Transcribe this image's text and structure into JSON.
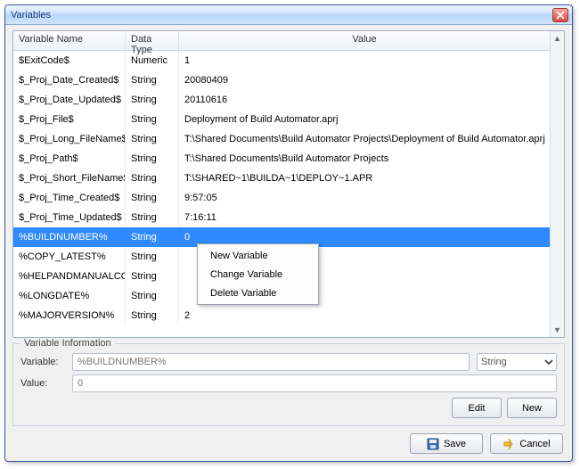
{
  "window": {
    "title": "Variables"
  },
  "grid": {
    "columns": [
      "Variable Name",
      "Data Type",
      "Value"
    ],
    "rows": [
      {
        "name": "$ExitCode$",
        "type": "Numeric",
        "value": "1",
        "selected": false
      },
      {
        "name": "$_Proj_Date_Created$",
        "type": "String",
        "value": "20080409",
        "selected": false
      },
      {
        "name": "$_Proj_Date_Updated$",
        "type": "String",
        "value": "20110616",
        "selected": false
      },
      {
        "name": "$_Proj_File$",
        "type": "String",
        "value": "Deployment of Build Automator.aprj",
        "selected": false
      },
      {
        "name": "$_Proj_Long_FileName$",
        "type": "String",
        "value": "T:\\Shared Documents\\Build Automator Projects\\Deployment of Build Automator.aprj",
        "selected": false
      },
      {
        "name": "$_Proj_Path$",
        "type": "String",
        "value": "T:\\Shared Documents\\Build Automator Projects",
        "selected": false
      },
      {
        "name": "$_Proj_Short_FileName$",
        "type": "String",
        "value": "T:\\SHARED~1\\BUILDA~1\\DEPLOY~1.APR",
        "selected": false
      },
      {
        "name": "$_Proj_Time_Created$",
        "type": "String",
        "value": "9:57:05",
        "selected": false
      },
      {
        "name": "$_Proj_Time_Updated$",
        "type": "String",
        "value": "7:16:11",
        "selected": false
      },
      {
        "name": "%BUILDNUMBER%",
        "type": "String",
        "value": "0",
        "selected": true
      },
      {
        "name": "%COPY_LATEST%",
        "type": "String",
        "value": "",
        "selected": false
      },
      {
        "name": "%HELPANDMANUALCOMP",
        "type": "String",
        "value": "",
        "selected": false
      },
      {
        "name": "%LONGDATE%",
        "type": "String",
        "value": "",
        "selected": false
      },
      {
        "name": "%MAJORVERSION%",
        "type": "String",
        "value": "2",
        "selected": false
      }
    ]
  },
  "contextmenu": [
    "New Variable",
    "Change Variable",
    "Delete Variable"
  ],
  "info": {
    "title": "Variable Information",
    "variable_label": "Variable:",
    "variable_value": "%BUILDNUMBER%",
    "type_value": "String",
    "value_label": "Value:",
    "value_value": "0",
    "edit_btn": "Edit",
    "new_btn": "New"
  },
  "buttons": {
    "save": "Save",
    "cancel": "Cancel"
  }
}
